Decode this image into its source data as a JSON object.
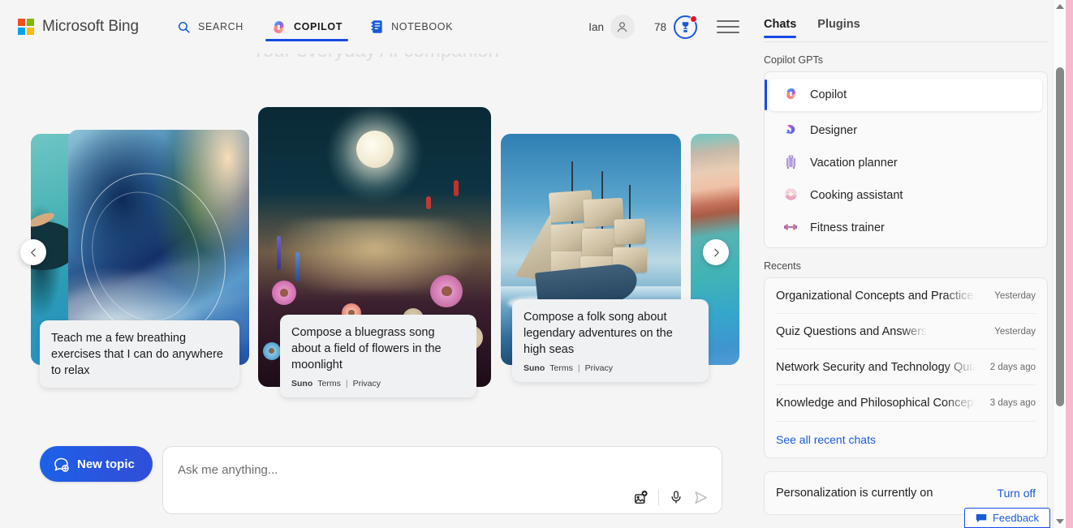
{
  "header": {
    "brand": "Microsoft Bing",
    "tabs": [
      {
        "label": "SEARCH",
        "icon": "search-icon",
        "active": false
      },
      {
        "label": "COPILOT",
        "icon": "copilot-icon",
        "active": true
      },
      {
        "label": "NOTEBOOK",
        "icon": "notebook-icon",
        "active": false
      }
    ],
    "account_name": "Ian",
    "rewards_count": "78",
    "menu_icon": "hamburger-menu-icon"
  },
  "hero": {
    "tagline": "Your everyday AI companion"
  },
  "carousel": {
    "prev_label": "‹",
    "next_label": "›",
    "cards": [
      {
        "id": "card-breathing",
        "prompt": "Teach me a few breathing exercises that I can do anywhere to relax",
        "attribution": "",
        "terms": "",
        "privacy": "",
        "separator": ""
      },
      {
        "id": "card-bluegrass",
        "prompt": "Compose a bluegrass song about a field of flowers in the moonlight",
        "attribution": "Suno",
        "terms": "Terms",
        "privacy": "Privacy",
        "separator": "|"
      },
      {
        "id": "card-folk-song",
        "prompt": "Compose a folk song about legendary adventures on the high seas",
        "attribution": "Suno",
        "terms": "Terms",
        "privacy": "Privacy",
        "separator": "|"
      }
    ]
  },
  "composer": {
    "new_topic_label": "New topic",
    "input_value": "",
    "input_placeholder": "Ask me anything...",
    "add_image_icon": "add-image-icon",
    "mic_icon": "microphone-icon",
    "send_icon": "send-icon"
  },
  "sidebar": {
    "tabs": [
      {
        "label": "Chats",
        "active": true
      },
      {
        "label": "Plugins",
        "active": false
      }
    ],
    "gpts_label": "Copilot GPTs",
    "gpts": [
      {
        "label": "Copilot",
        "emoji": "🌈",
        "selected": true
      },
      {
        "label": "Designer",
        "emoji": "🎨",
        "selected": false
      },
      {
        "label": "Vacation planner",
        "emoji": "🧳",
        "selected": false
      },
      {
        "label": "Cooking assistant",
        "emoji": "🍩",
        "selected": false
      },
      {
        "label": "Fitness trainer",
        "emoji": "🏋️",
        "selected": false
      }
    ],
    "recents_label": "Recents",
    "recents": [
      {
        "title": "Organizational Concepts and Practices",
        "time": "Yesterday"
      },
      {
        "title": "Quiz Questions and Answers",
        "time": "Yesterday"
      },
      {
        "title": "Network Security and Technology Quiz",
        "time": "2 days ago"
      },
      {
        "title": "Knowledge and Philosophical Concepts",
        "time": "3 days ago"
      }
    ],
    "see_all_label": "See all recent chats",
    "personalization_text": "Personalization is currently on",
    "personalization_action": "Turn off"
  },
  "feedback": {
    "label": "Feedback",
    "icon": "feedback-icon"
  },
  "colors": {
    "accent": "#174ae4",
    "link": "#1a5adb",
    "notification": "#e81123",
    "page_bg": "#f5f5f5",
    "page_edge": "#f9b8d0"
  }
}
